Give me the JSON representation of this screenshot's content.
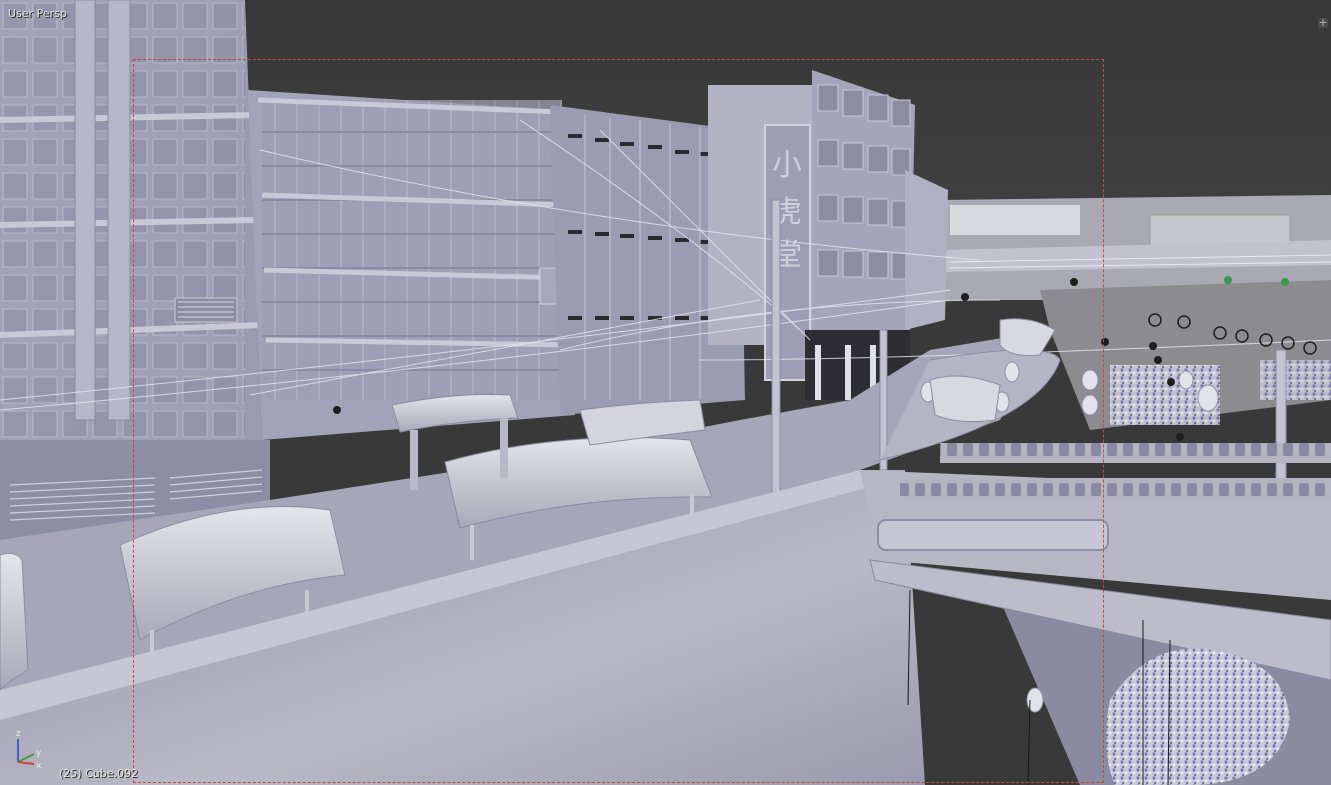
{
  "viewport": {
    "view_label": "User Persp",
    "object_label": "(25) Cube.092",
    "corner_widget": "+",
    "colors": {
      "background": "#393939",
      "camera_frame": "#cc4444",
      "axis_x": "#d04040",
      "axis_y": "#40a040",
      "axis_z": "#4060d0"
    }
  },
  "axis_gizmo": {
    "z_label": "z",
    "y_label": "y",
    "x_label": "x"
  },
  "signboard": {
    "glyphs": [
      "小",
      "虎",
      "堂"
    ]
  }
}
